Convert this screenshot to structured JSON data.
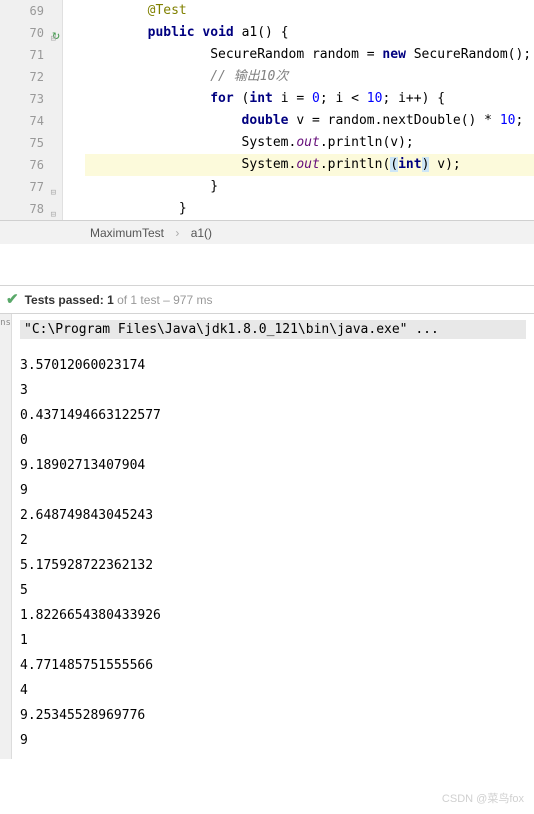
{
  "editor": {
    "lines": [
      {
        "num": "69",
        "indent": 2,
        "tokens": [
          {
            "t": "@Test",
            "c": "annotation"
          }
        ]
      },
      {
        "num": "70",
        "indent": 2,
        "icons": [
          "cycle",
          "fold-open"
        ],
        "tokens": [
          {
            "t": "public ",
            "c": "kw"
          },
          {
            "t": "void ",
            "c": "kw"
          },
          {
            "t": "a1() {"
          }
        ]
      },
      {
        "num": "71",
        "indent": 4,
        "tokens": [
          {
            "t": "SecureRandom random = "
          },
          {
            "t": "new ",
            "c": "kw"
          },
          {
            "t": "SecureRandom();"
          }
        ]
      },
      {
        "num": "72",
        "indent": 4,
        "tokens": [
          {
            "t": "// 输出10次",
            "c": "comment"
          }
        ]
      },
      {
        "num": "73",
        "indent": 4,
        "tokens": [
          {
            "t": "for ",
            "c": "kw"
          },
          {
            "t": "("
          },
          {
            "t": "int ",
            "c": "kw"
          },
          {
            "t": "i"
          },
          {
            "t": " = "
          },
          {
            "t": "0",
            "c": "num"
          },
          {
            "t": "; "
          },
          {
            "t": "i"
          },
          {
            "t": " < "
          },
          {
            "t": "10",
            "c": "num"
          },
          {
            "t": "; i++) {"
          }
        ]
      },
      {
        "num": "74",
        "indent": 5,
        "tokens": [
          {
            "t": "double ",
            "c": "kw"
          },
          {
            "t": "v = random.nextDouble() * "
          },
          {
            "t": "10",
            "c": "num"
          },
          {
            "t": ";"
          }
        ]
      },
      {
        "num": "75",
        "indent": 5,
        "tokens": [
          {
            "t": "System."
          },
          {
            "t": "out",
            "c": "static-field"
          },
          {
            "t": ".println(v);"
          }
        ]
      },
      {
        "num": "76",
        "indent": 5,
        "hl": true,
        "tokens": [
          {
            "t": "System."
          },
          {
            "t": "out",
            "c": "static-field"
          },
          {
            "t": ".println("
          },
          {
            "t": "(",
            "c": "paren-hl"
          },
          {
            "t": "int",
            "c": "kw"
          },
          {
            "t": ")",
            "c": "paren-hl"
          },
          {
            "t": " v);"
          }
        ]
      },
      {
        "num": "77",
        "indent": 4,
        "icons": [
          "fold-close"
        ],
        "tokens": [
          {
            "t": "}"
          }
        ]
      },
      {
        "num": "78",
        "indent": 3,
        "icons": [
          "fold-close"
        ],
        "tokens": [
          {
            "t": "}"
          }
        ]
      }
    ]
  },
  "breadcrumb": {
    "class": "MaximumTest",
    "method": "a1()"
  },
  "tests": {
    "label_prefix": "Tests passed: ",
    "passed": "1",
    "label_mid": " of 1 test",
    "time": " – 977 ms"
  },
  "console": {
    "cmd": "\"C:\\Program Files\\Java\\jdk1.8.0_121\\bin\\java.exe\" ...",
    "tab_label": "ns",
    "output": [
      "3.57012060023174",
      "3",
      "0.4371494663122577",
      "0",
      "9.18902713407904",
      "9",
      "2.648749843045243",
      "2",
      "5.175928722362132",
      "5",
      "1.8226654380433926",
      "1",
      "4.771485751555566",
      "4",
      "9.25345528969776",
      "9"
    ]
  },
  "watermark": "CSDN @菜鸟fox"
}
